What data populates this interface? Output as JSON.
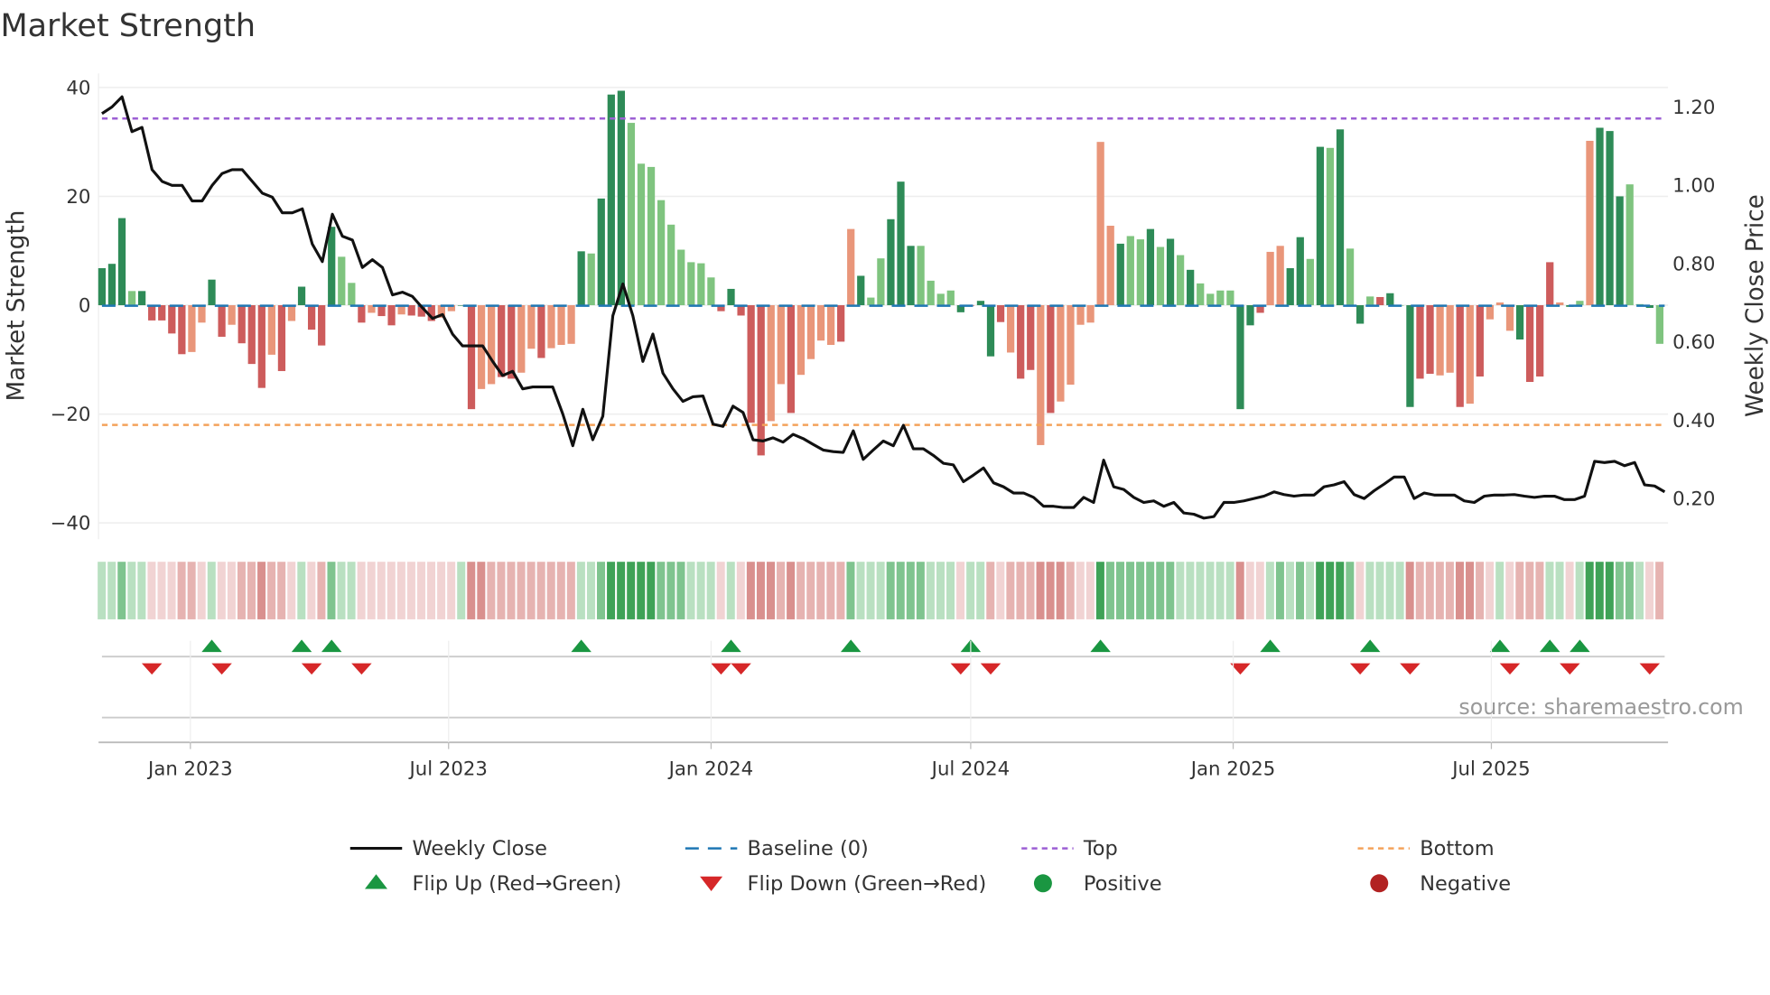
{
  "title": "Market Strength",
  "source": "source: sharemaestro.com",
  "colors": {
    "dark_green": "#2e8b57",
    "light_green": "#7fc47f",
    "red": "#cd5c5c",
    "salmon": "#e9967a",
    "close": "#111111",
    "baseline": "#1f77b4",
    "top": "#9c5fd4",
    "bottom": "#f4a25b",
    "flip_up": "#1a9641",
    "flip_down": "#d62728",
    "positive": "#1a9641",
    "negative": "#b22222"
  },
  "chart_data": {
    "type": "bar",
    "title": "Market Strength",
    "ylabel": "Market Strength",
    "y2label": "Weekly Close Price",
    "ylim": [
      -43,
      42.6
    ],
    "y2lim": [
      0.096,
      1.286
    ],
    "yticks": [
      "−40",
      "−20",
      "0",
      "20",
      "40"
    ],
    "yticks_values": [
      -40,
      -20,
      0,
      20,
      40
    ],
    "y2ticks": [
      "0.20",
      "0.40",
      "0.60",
      "0.80",
      "1.00",
      "1.20"
    ],
    "y2ticks_values": [
      0.2,
      0.4,
      0.6,
      0.8,
      1.0,
      1.2
    ],
    "x_start": "2022-10-31",
    "x_step_days": 7,
    "xticks": [
      {
        "label": "Jan 2023",
        "date": "2023-01-01"
      },
      {
        "label": "Jul 2023",
        "date": "2023-07-01"
      },
      {
        "label": "Jan 2024",
        "date": "2024-01-01"
      },
      {
        "label": "Jul 2024",
        "date": "2024-07-01"
      },
      {
        "label": "Jan 2025",
        "date": "2025-01-01"
      },
      {
        "label": "Jul 2025",
        "date": "2025-07-01"
      }
    ],
    "top": 34.3,
    "bottom": -22,
    "strength": [
      6.8,
      7.6,
      16,
      2.6,
      2.6,
      -2.8,
      -2.8,
      -5.2,
      -9,
      -8.6,
      -3.2,
      4.7,
      -5.8,
      -3.6,
      -7,
      -10.8,
      -15.2,
      -9.1,
      -12.1,
      -2.9,
      3.4,
      -4.5,
      -7.4,
      14.4,
      8.9,
      4.1,
      -3.2,
      -1.4,
      -2,
      -3.7,
      -1.7,
      -1.9,
      -2.1,
      -2.9,
      -2.3,
      -1.1,
      0,
      -19.1,
      -15.4,
      -14.5,
      -13.2,
      -13.5,
      -12.4,
      -8,
      -9.7,
      -7.9,
      -7.3,
      -7.1,
      9.9,
      9.5,
      19.6,
      38.7,
      39.4,
      33.5,
      26,
      25.4,
      19.3,
      14.8,
      10.2,
      7.9,
      7.7,
      5.1,
      -1.1,
      3,
      -1.9,
      -21.6,
      -27.6,
      -21.3,
      -14.5,
      -19.8,
      -12.8,
      -9.9,
      -6.5,
      -7.3,
      -6.7,
      14,
      5.4,
      1.4,
      8.6,
      15.8,
      22.7,
      10.9,
      10.9,
      4.5,
      2.1,
      2.7,
      -1.3,
      0,
      0.8,
      -9.4,
      -3.1,
      -8.7,
      -13.5,
      -11.9,
      -25.7,
      -19.8,
      -17.7,
      -14.6,
      -3.6,
      -3.2,
      30,
      14.6,
      11.3,
      12.7,
      12.1,
      14,
      10.7,
      12.2,
      9.2,
      6.5,
      4,
      2.1,
      2.7,
      2.7,
      -19.1,
      -3.7,
      -1.4,
      9.8,
      10.9,
      6.8,
      12.5,
      8.5,
      29.1,
      28.9,
      32.3,
      10.4,
      -3.4,
      1.6,
      1.5,
      2.2,
      0,
      -18.7,
      -13.5,
      -12.6,
      -12.9,
      -12.4,
      -18.7,
      -18.1,
      -13.1,
      -2.6,
      0.5,
      -4.7,
      -6.3,
      -14.1,
      -13.1,
      7.9,
      0.5,
      -0.3,
      0.8,
      30.2,
      32.6,
      32,
      20,
      22.2,
      0.2,
      -0.5,
      -7.1
    ],
    "shade": "gggGgrrrrssgrsrrrsrsgrrgGGrsrrsrrrss-rssrrssrsssgGggg GGGGGGGGGrgrrrssrssssrsgGGgggGGGGgr-grsrrsrssssssgGGg GgGgGGGGggrssggGgGgGgGrgGg-rssrsrsssgrrrsgGsgggGGgGrr",
    "close": [
      1.183,
      1.2,
      1.226,
      1.137,
      1.148,
      1.04,
      1.01,
      1.0,
      1.0,
      0.96,
      0.96,
      1.0,
      1.03,
      1.04,
      1.04,
      1.01,
      0.98,
      0.97,
      0.93,
      0.93,
      0.94,
      0.85,
      0.805,
      0.926,
      0.87,
      0.86,
      0.79,
      0.81,
      0.79,
      0.72,
      0.727,
      0.716,
      0.687,
      0.66,
      0.67,
      0.62,
      0.59,
      0.59,
      0.59,
      0.55,
      0.514,
      0.525,
      0.48,
      0.485,
      0.485,
      0.485,
      0.416,
      0.335,
      0.428,
      0.35,
      0.41,
      0.667,
      0.748,
      0.667,
      0.55,
      0.62,
      0.52,
      0.48,
      0.448,
      0.46,
      0.462,
      0.39,
      0.384,
      0.436,
      0.42,
      0.35,
      0.347,
      0.355,
      0.344,
      0.364,
      0.353,
      0.338,
      0.324,
      0.32,
      0.318,
      0.373,
      0.3,
      0.324,
      0.347,
      0.335,
      0.387,
      0.327,
      0.327,
      0.31,
      0.29,
      0.286,
      0.243,
      0.26,
      0.278,
      0.24,
      0.23,
      0.214,
      0.214,
      0.203,
      0.18,
      0.18,
      0.177,
      0.177,
      0.203,
      0.19,
      0.298,
      0.23,
      0.223,
      0.203,
      0.19,
      0.194,
      0.18,
      0.19,
      0.163,
      0.16,
      0.15,
      0.154,
      0.19,
      0.19,
      0.194,
      0.2,
      0.206,
      0.217,
      0.21,
      0.206,
      0.209,
      0.209,
      0.23,
      0.235,
      0.243,
      0.21,
      0.2,
      0.22,
      0.237,
      0.255,
      0.255,
      0.2,
      0.214,
      0.209,
      0.209,
      0.209,
      0.194,
      0.19,
      0.206,
      0.209,
      0.209,
      0.21,
      0.206,
      0.203,
      0.206,
      0.206,
      0.197,
      0.197,
      0.206,
      0.295,
      0.292,
      0.295,
      0.284,
      0.292,
      0.235,
      0.232,
      0.217
    ],
    "flip_up_weeks": [
      11,
      20,
      23,
      48,
      63,
      75,
      87,
      100,
      117,
      127,
      140,
      145,
      148
    ],
    "flip_down_weeks": [
      5,
      12,
      21,
      26,
      62,
      64,
      86,
      89,
      114,
      126,
      131,
      141,
      147,
      155
    ],
    "legend": {
      "placement": "bottom",
      "items": [
        {
          "label": "Weekly Close",
          "kind": "line"
        },
        {
          "label": "Baseline (0)",
          "kind": "dash"
        },
        {
          "label": "Top",
          "kind": "dot-top"
        },
        {
          "label": "Bottom",
          "kind": "dot-bottom"
        },
        {
          "label": "Flip Up (Red→Green)",
          "kind": "tri-up"
        },
        {
          "label": "Flip Down (Green→Red)",
          "kind": "tri-down"
        },
        {
          "label": "Positive",
          "kind": "circle-pos"
        },
        {
          "label": "Negative",
          "kind": "circle-neg"
        }
      ]
    }
  }
}
